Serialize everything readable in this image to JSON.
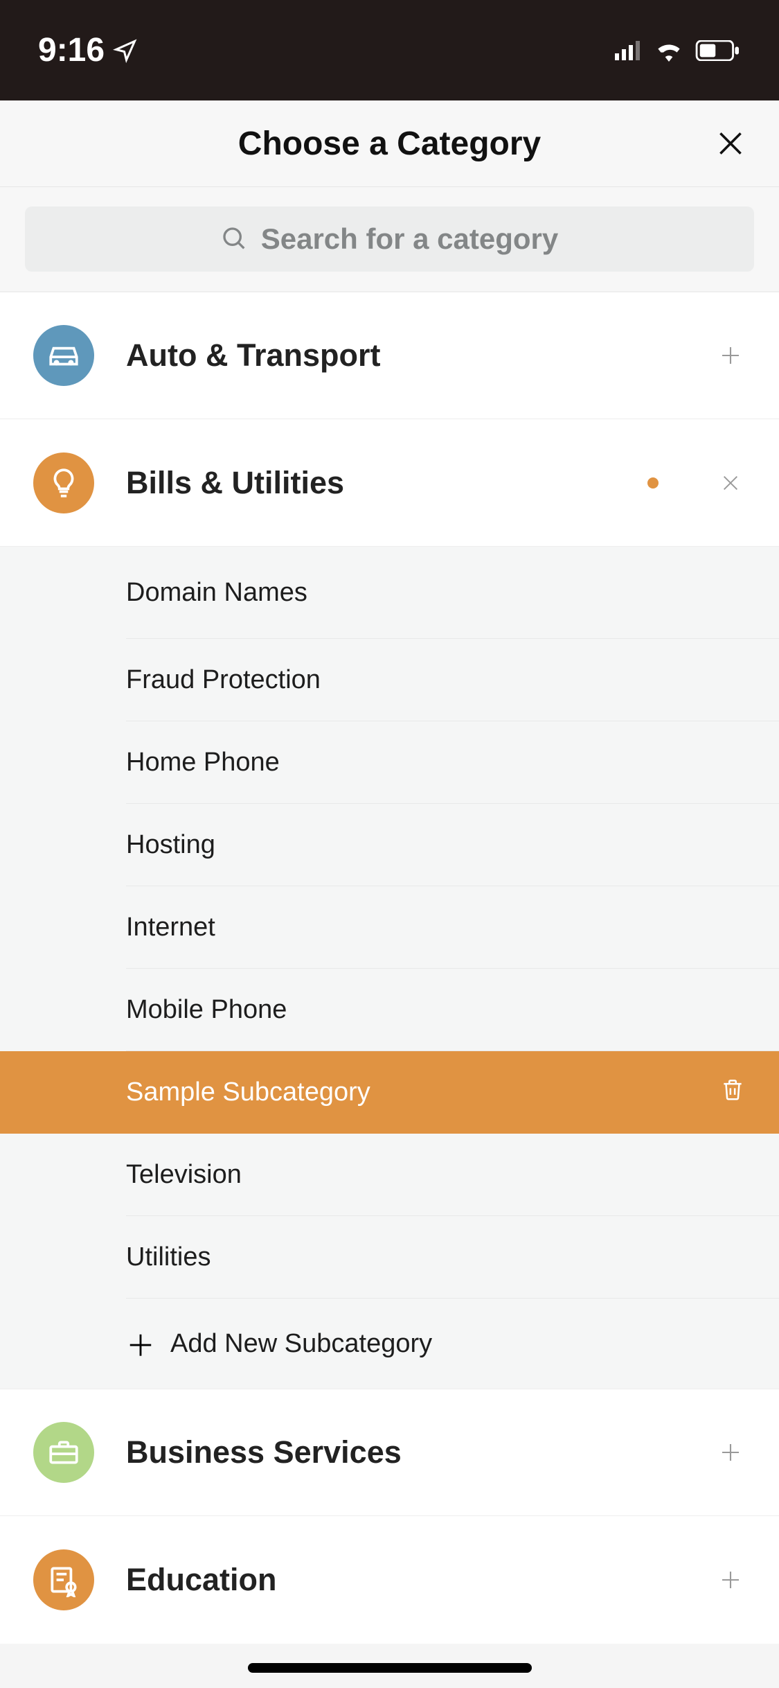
{
  "statusbar": {
    "time": "9:16"
  },
  "header": {
    "title": "Choose a Category"
  },
  "search": {
    "placeholder": "Search for a category"
  },
  "categories": [
    {
      "label": "Auto & Transport",
      "icon": "car",
      "color": "blue",
      "expanded": false
    },
    {
      "label": "Bills & Utilities",
      "icon": "lightbulb",
      "color": "orange",
      "expanded": true,
      "subcategories": [
        {
          "label": "Domain Names"
        },
        {
          "label": "Fraud Protection"
        },
        {
          "label": "Home Phone"
        },
        {
          "label": "Hosting"
        },
        {
          "label": "Internet"
        },
        {
          "label": "Mobile Phone"
        },
        {
          "label": "Sample Subcategory",
          "selected": true,
          "deletable": true
        },
        {
          "label": "Television"
        },
        {
          "label": "Utilities"
        }
      ],
      "add_label": "Add New Subcategory"
    },
    {
      "label": "Business Services",
      "icon": "briefcase",
      "color": "green",
      "expanded": false
    },
    {
      "label": "Education",
      "icon": "certificate",
      "color": "orange",
      "expanded": false
    }
  ]
}
